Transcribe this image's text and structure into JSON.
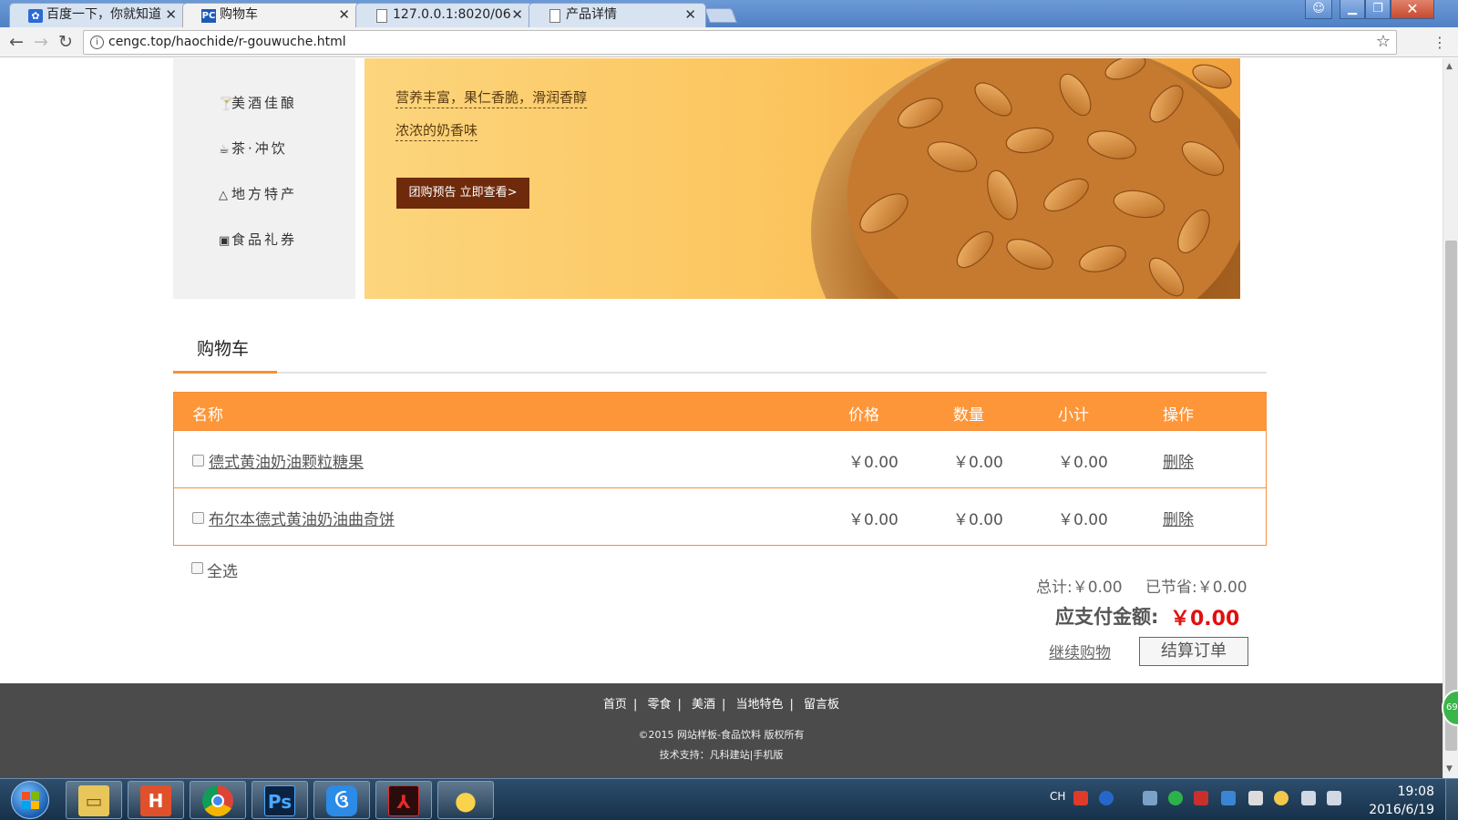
{
  "browser": {
    "tabs": [
      {
        "title": "百度一下，你就知道",
        "icon": "baidu-paw-icon"
      },
      {
        "title": "购物车",
        "icon": "pc-icon"
      },
      {
        "title": "127.0.0.1:8020/06",
        "icon": "page-icon"
      },
      {
        "title": "产品详情",
        "icon": "page-icon"
      }
    ],
    "url": "cengc.top/haochide/r-gouwuche.html"
  },
  "sidebar": {
    "items": [
      {
        "label": "美酒佳酿",
        "icon": "wine-glass-icon"
      },
      {
        "label": "茶·冲饮",
        "icon": "tea-cup-icon"
      },
      {
        "label": "地方特产",
        "icon": "mountain-icon"
      },
      {
        "label": "食品礼券",
        "icon": "gift-box-icon"
      }
    ]
  },
  "banner": {
    "line1": "营养丰富，果仁香脆，滑润香醇",
    "line2": "浓浓的奶香味",
    "cta": "团购预告 立即查看>"
  },
  "cart": {
    "section_title": "购物车",
    "columns": {
      "name": "名称",
      "price": "价格",
      "qty": "数量",
      "subtotal": "小计",
      "action": "操作"
    },
    "rows": [
      {
        "name": "德式黄油奶油颗粒糖果",
        "price": "￥0.00",
        "qty": "￥0.00",
        "subtotal": "￥0.00",
        "action": "删除"
      },
      {
        "name": "布尔本德式黄油奶油曲奇饼",
        "price": "￥0.00",
        "qty": "￥0.00",
        "subtotal": "￥0.00",
        "action": "删除"
      }
    ],
    "select_all": "全选",
    "total": "总计:￥0.00",
    "saved": "已节省:￥0.00",
    "pay_label": "应支付金额:",
    "pay_amount": "￥0.00",
    "continue": "继续购物",
    "checkout": "结算订单"
  },
  "footer": {
    "links": [
      "首页",
      "零食",
      "美酒",
      "当地特色",
      "留言板"
    ],
    "copyright": "©2015 网站样板-食品饮料 版权所有",
    "support": "技术支持：凡科建站|手机版"
  },
  "taskbar": {
    "lang": "CH",
    "time": "19:08",
    "date": "2016/6/19",
    "float_badge": "69"
  },
  "colors": {
    "accent": "#fd9639",
    "price_red": "#e01010",
    "footer_bg": "#4b4b4b"
  }
}
